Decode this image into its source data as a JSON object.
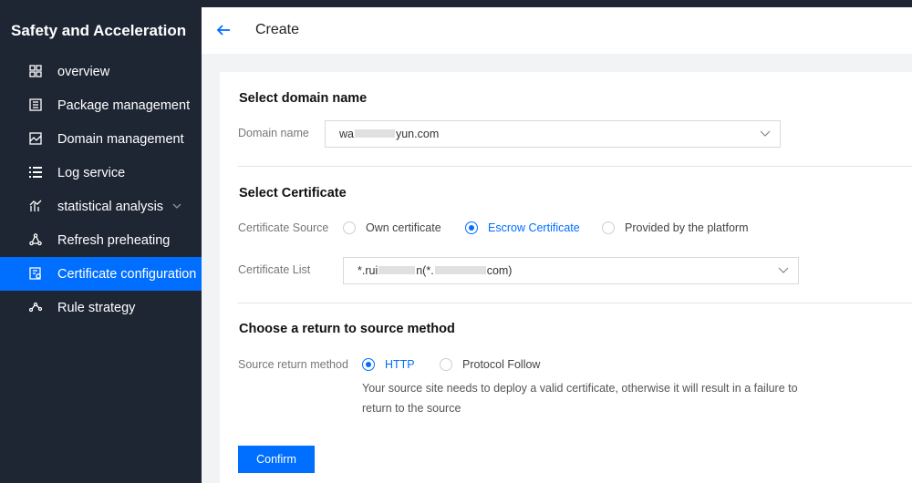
{
  "sidebar": {
    "title": "Safety and Acceleration",
    "items": [
      {
        "label": "overview",
        "icon": "grid-icon",
        "active": false
      },
      {
        "label": "Package management",
        "icon": "package-icon",
        "active": false
      },
      {
        "label": "Domain management",
        "icon": "domain-icon",
        "active": false
      },
      {
        "label": "Log service",
        "icon": "list-icon",
        "active": false
      },
      {
        "label": "statistical analysis",
        "icon": "chart-icon",
        "active": false,
        "expandable": true
      },
      {
        "label": "Refresh preheating",
        "icon": "refresh-icon",
        "active": false
      },
      {
        "label": "Certificate configuration",
        "icon": "certificate-icon",
        "active": true
      },
      {
        "label": "Rule strategy",
        "icon": "rule-icon",
        "active": false
      }
    ]
  },
  "header": {
    "title": "Create"
  },
  "form": {
    "domain_section": {
      "title": "Select domain name",
      "label": "Domain name",
      "value_prefix": "wa",
      "value_suffix": "yun.com"
    },
    "certificate_section": {
      "title": "Select Certificate",
      "source_label": "Certificate Source",
      "options": [
        "Own certificate",
        "Escrow Certificate",
        "Provided by the platform"
      ],
      "selected": "Escrow Certificate",
      "list_label": "Certificate List",
      "list_value_prefix": "*.rui",
      "list_value_mid": "n(*.",
      "list_value_suffix": "com)"
    },
    "source_section": {
      "title": "Choose a return to source method",
      "label": "Source return method",
      "options": [
        "HTTP",
        "Protocol Follow"
      ],
      "selected": "HTTP",
      "hint": "Your source site needs to deploy a valid certificate, otherwise it will result in a failure to return to the source"
    },
    "confirm_label": "Confirm"
  },
  "colors": {
    "accent": "#006eff",
    "sidebar_bg": "#1e2533"
  }
}
